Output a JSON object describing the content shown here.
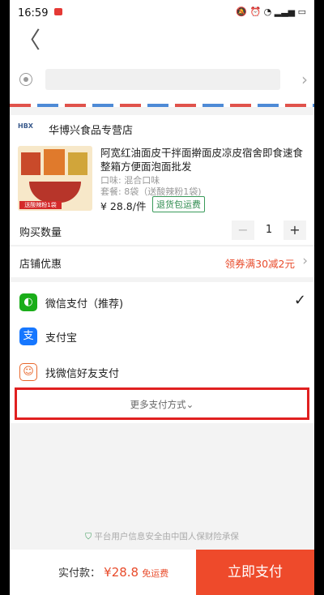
{
  "status_bar": {
    "time": "16:59",
    "icons": "🔕 ⏰ ◔ ▂▃▅ ▭"
  },
  "topbar": {
    "back": "〈"
  },
  "address": {
    "chevron": "›"
  },
  "store": {
    "logo": "HBX",
    "name": "华博兴食品专营店"
  },
  "product": {
    "title": "阿宽红油面皮干拌面擀面皮凉皮宿舍即食速食整箱方便面泡面批发",
    "flavor": "口味: 混合口味",
    "package": "套餐: 8袋（送酸辣粉1袋)",
    "price": "¥ 28.8/件",
    "badge": "退货包运费",
    "thumb_tag": "送酸辣粉1袋"
  },
  "quantity": {
    "label": "购买数量",
    "minus": "−",
    "value": "1",
    "plus": "+"
  },
  "discount": {
    "label": "店铺优惠",
    "offer": "领券满30减2元",
    "chevron": "›"
  },
  "payment": {
    "options": [
      {
        "label": "微信支付（推荐)",
        "icon": "wechat-icon",
        "color": "#1aad19",
        "selected": true
      },
      {
        "label": "支付宝",
        "icon": "alipay-icon",
        "color": "#1677ff",
        "selected": false
      },
      {
        "label": "找微信好友支付",
        "icon": "friends-icon",
        "color": "#e8672b",
        "selected": false
      }
    ],
    "more": "更多支付方式⌄",
    "check": "✓"
  },
  "security": {
    "text": "平台用户信息安全由中国人保财险承保"
  },
  "footer": {
    "label": "实付款：",
    "amount": "¥28.8",
    "free_shipping": "免运费",
    "pay_button": "立即支付"
  }
}
